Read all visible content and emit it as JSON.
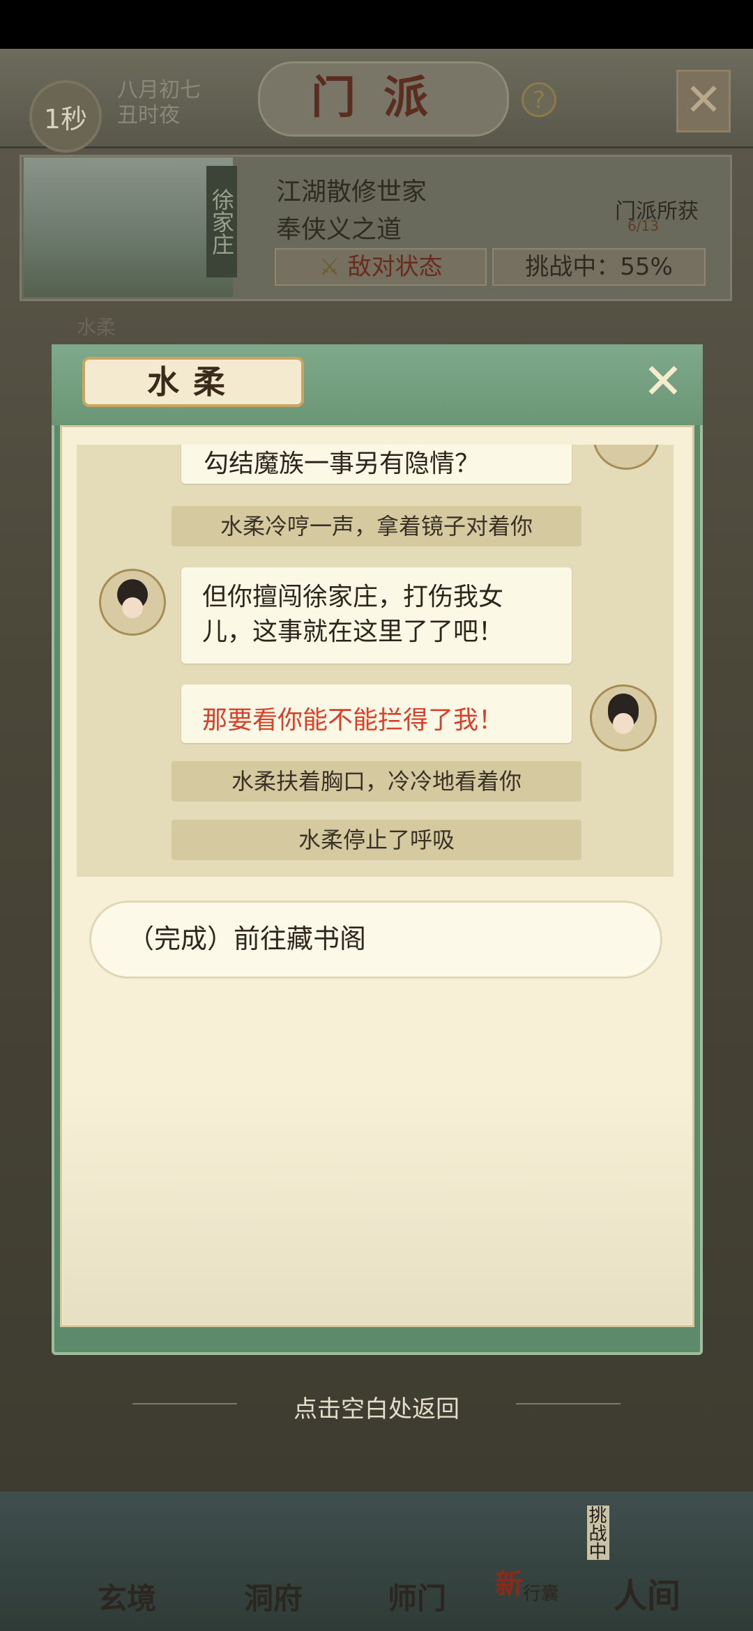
{
  "header": {
    "timer": "1秒",
    "date_line1": "八月初七",
    "date_line2": "丑时夜",
    "title": "门派",
    "help_icon": "?"
  },
  "sect": {
    "name_tag": "徐家庄",
    "line1": "江湖散修世家",
    "line2": "奉侠义之道",
    "status_label": "敌对状态",
    "challenge_label": "挑战中：55%",
    "rewards_title": "门派所获",
    "rewards_count": "6/13",
    "behind_label": "水柔"
  },
  "dialog": {
    "title": "水柔",
    "messages": [
      {
        "type": "bubble-right",
        "text": "勾结魔族一事另有隐情？"
      },
      {
        "type": "narration",
        "text": "水柔冷哼一声，拿着镜子对着你"
      },
      {
        "type": "bubble-left",
        "text": "但你擅闯徐家庄，打伤我女儿，这事就在这里了了吧！"
      },
      {
        "type": "bubble-right-highlight",
        "text": "那要看你能不能拦得了我！"
      },
      {
        "type": "narration",
        "text": "水柔扶着胸口，冷冷地看着你"
      },
      {
        "type": "narration",
        "text": "水柔停止了呼吸"
      }
    ],
    "quest_option": "（完成）前往藏书阁"
  },
  "footer_hint": "点击空白处返回",
  "bottom_nav": {
    "items": [
      "玄境",
      "洞府",
      "师门",
      "行囊",
      "人间"
    ],
    "new_badge": "新",
    "challenge_tag": "挑战中"
  },
  "colors": {
    "highlight_text": "#d9402c",
    "dialog_green": "#5d8a6a",
    "parchment": "#f7f0d6"
  }
}
